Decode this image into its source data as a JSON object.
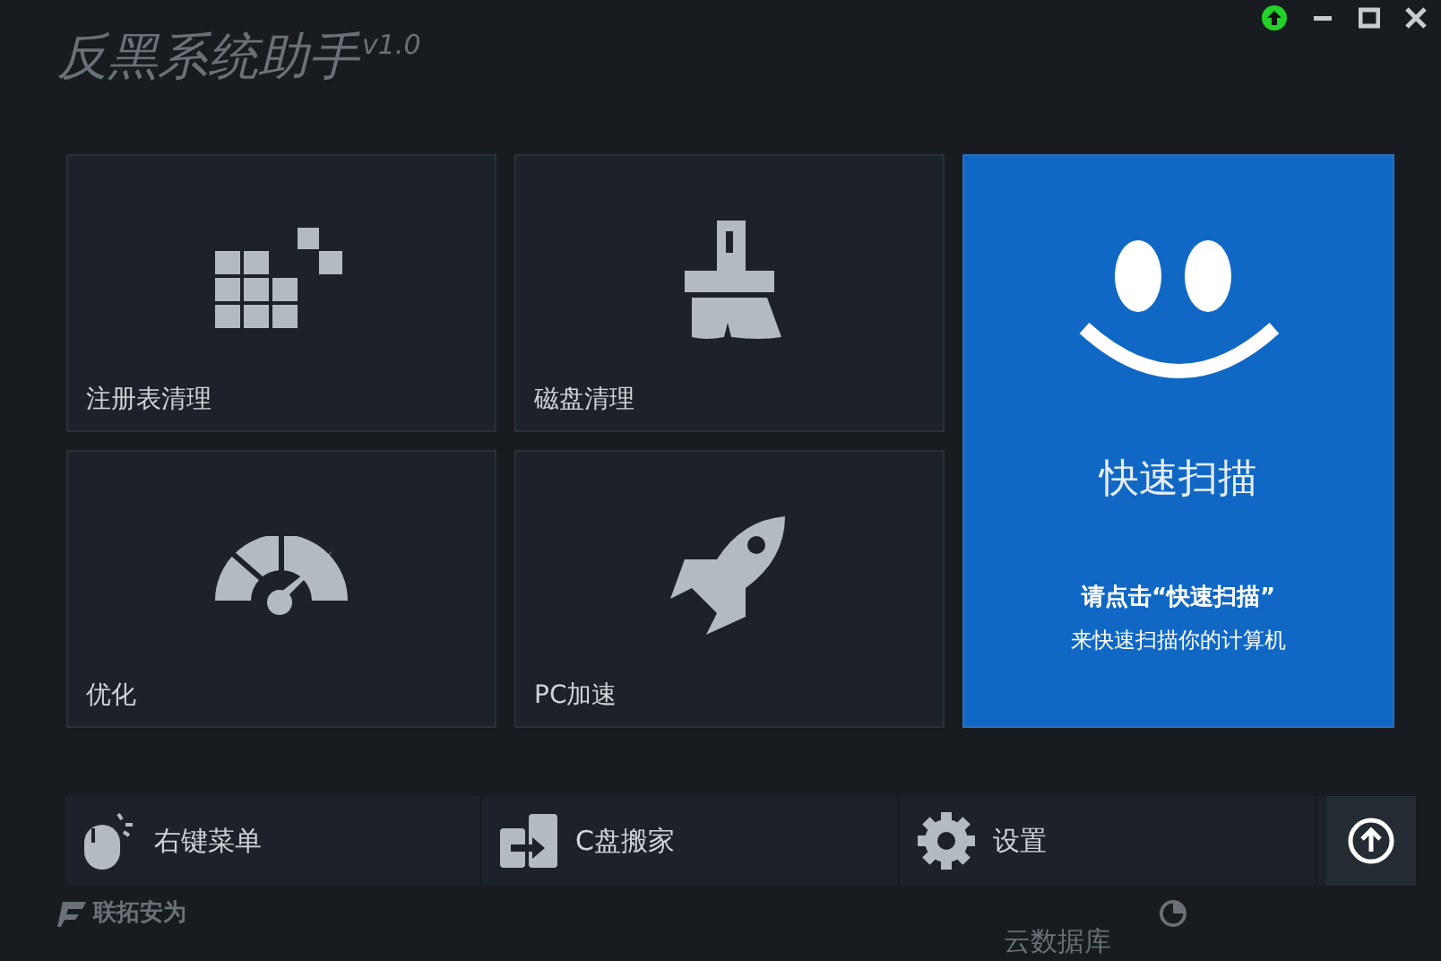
{
  "window": {
    "title": "反黑系统助手",
    "version": "v1.0"
  },
  "tiles": [
    {
      "label": "注册表清理"
    },
    {
      "label": "磁盘清理"
    },
    {
      "label": "优化"
    },
    {
      "label": "PC加速"
    }
  ],
  "scan": {
    "title": "快速扫描",
    "hint": "请点击“快速扫描”",
    "subhint": "来快速扫描你的计算机"
  },
  "toolbar": [
    {
      "label": "右键菜单"
    },
    {
      "label": "C盘搬家"
    },
    {
      "label": "设置"
    }
  ],
  "status_bar": {
    "brand": "联拓安为",
    "cloud": "云数据库"
  }
}
